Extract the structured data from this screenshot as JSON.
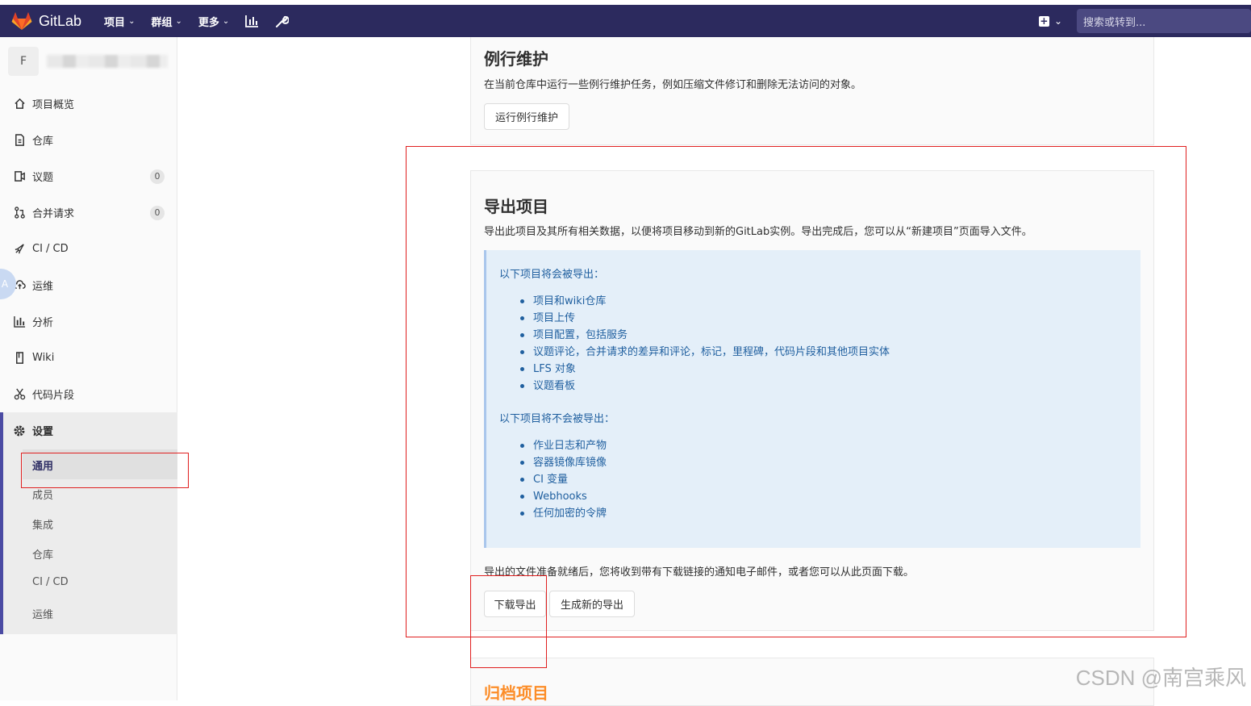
{
  "navbar": {
    "brand": "GitLab",
    "menu": [
      {
        "label": "项目"
      },
      {
        "label": "群组"
      },
      {
        "label": "更多"
      }
    ],
    "search_placeholder": "搜索或转到...",
    "brand_color": "#2c2a5e"
  },
  "sidebar": {
    "project_avatar_letter": "F",
    "items": [
      {
        "label": "项目概览",
        "icon": "home-icon"
      },
      {
        "label": "仓库",
        "icon": "document-icon"
      },
      {
        "label": "议题",
        "icon": "issues-icon",
        "badge": "0"
      },
      {
        "label": "合并请求",
        "icon": "merge-request-icon",
        "badge": "0"
      },
      {
        "label": "CI / CD",
        "icon": "rocket-icon"
      },
      {
        "label": "运维",
        "icon": "cloud-icon"
      },
      {
        "label": "分析",
        "icon": "chart-icon"
      },
      {
        "label": "Wiki",
        "icon": "book-icon"
      },
      {
        "label": "代码片段",
        "icon": "scissors-icon"
      }
    ],
    "settings": {
      "label": "设置",
      "icon": "gear-icon",
      "sub_items": [
        "通用",
        "成员",
        "集成",
        "仓库",
        "CI / CD",
        "运维"
      ]
    }
  },
  "housekeeping": {
    "title": "例行维护",
    "description": "在当前仓库中运行一些例行维护任务，例如压缩文件修订和删除无法访问的对象。",
    "button": "运行例行维护"
  },
  "export": {
    "title": "导出项目",
    "description": "导出此项目及其所有相关数据，以便将项目移动到新的GitLab实例。导出完成后，您可以从“新建项目”页面导入文件。",
    "will_export_heading": "以下项目将会被导出：",
    "will_export": [
      "项目和wiki仓库",
      "项目上传",
      "项目配置，包括服务",
      "议题评论，合并请求的差异和评论，标记，里程碑，代码片段和其他项目实体",
      "LFS 对象",
      "议题看板"
    ],
    "wont_export_heading": "以下项目将不会被导出：",
    "wont_export": [
      "作业日志和产物",
      "容器镜像库镜像",
      "CI 变量",
      "Webhooks",
      "任何加密的令牌"
    ],
    "ready_note": "导出的文件准备就绪后，您将收到带有下载链接的通知电子邮件，或者您可以从此页面下载。",
    "download_button": "下载导出",
    "generate_button": "生成新的导出"
  },
  "archive": {
    "title": "归档项目",
    "title_color": "#fc8d28"
  },
  "watermark": "CSDN @南宫乘风"
}
